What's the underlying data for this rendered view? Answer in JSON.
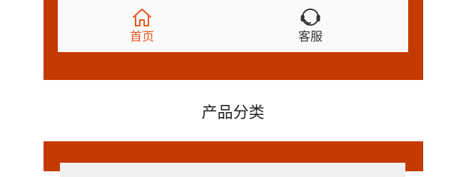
{
  "tabs": [
    {
      "label": "首页",
      "icon": "home-icon",
      "active": true
    },
    {
      "label": "客服",
      "icon": "headset-icon",
      "active": false
    }
  ],
  "section": {
    "title": "产品分类"
  },
  "colors": {
    "frame": "#c53a00",
    "active": "#e8541e",
    "inactive": "#333333",
    "tabbar_bg": "#fafafa",
    "panel_bg": "#efefef"
  }
}
